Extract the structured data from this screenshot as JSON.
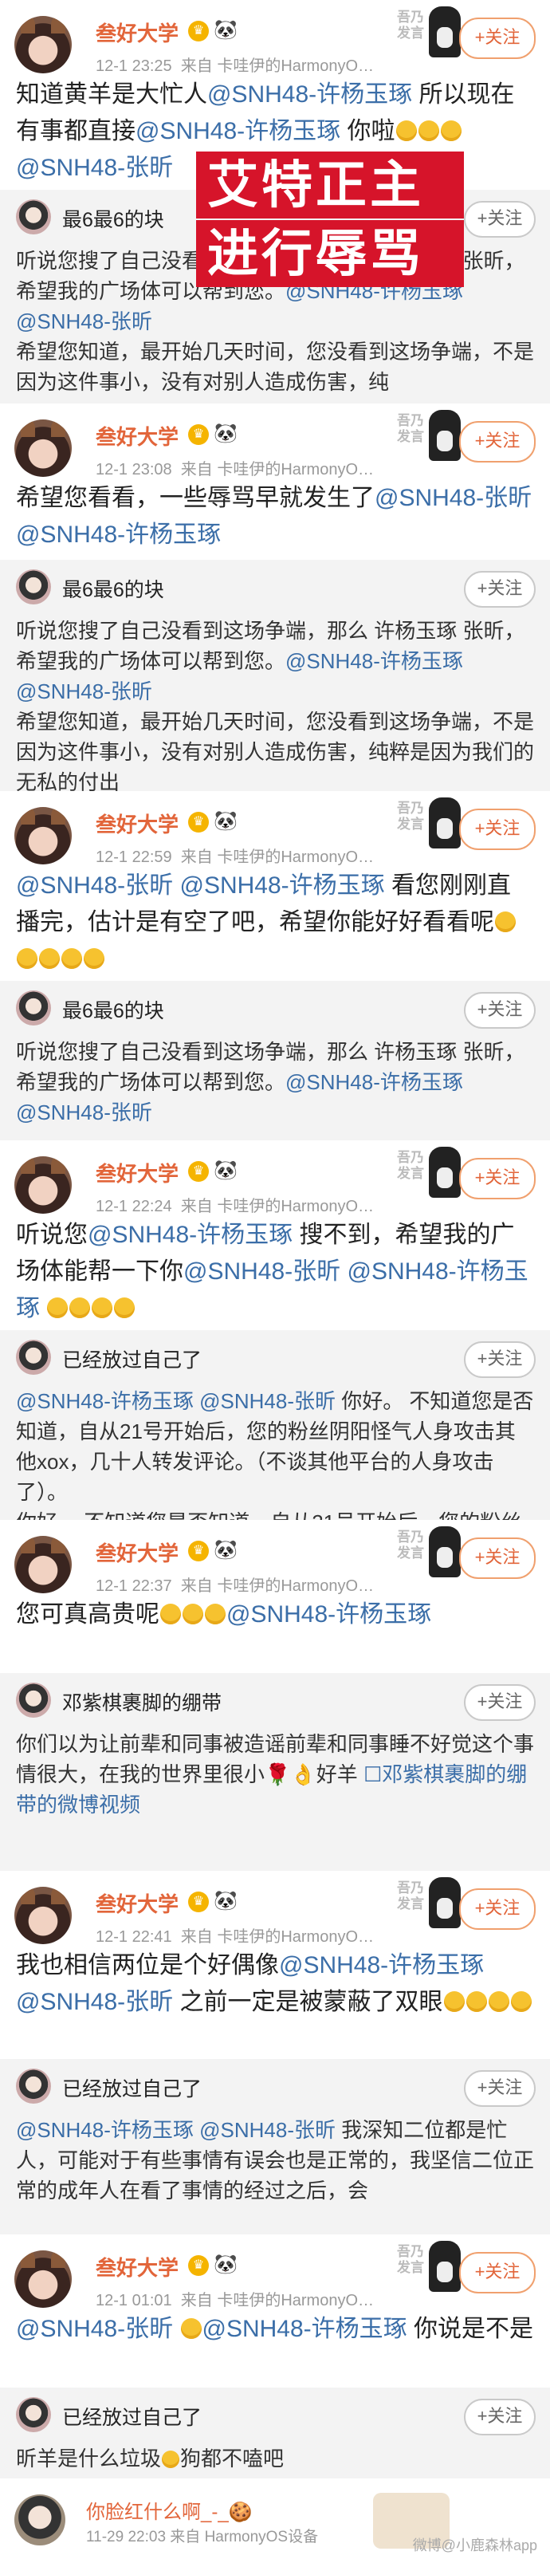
{
  "overlay": {
    "line1": "艾特正主",
    "line2": "进行辱骂"
  },
  "main_user": {
    "name": "叁好大学",
    "badge": "♛",
    "panda": "🐼",
    "follow_label": "+关注",
    "sticker_text": "吾乃发言"
  },
  "quote_follow_label": "+关注",
  "posts": [
    {
      "time": "12-1 23:25",
      "source": "来自 卡哇伊的HarmonyO…",
      "text_parts": [
        {
          "t": "知道黄羊是大忙人"
        },
        {
          "t": "@SNH48-许杨玉琢",
          "at": true
        },
        {
          "t": " 所以现在有事都直接"
        },
        {
          "t": "@SNH48-许杨玉琢",
          "at": true
        },
        {
          "t": " 你啦"
        },
        {
          "emo": 3
        },
        {
          "t": "\n"
        },
        {
          "t": "@SNH48-张昕",
          "at": true
        }
      ]
    },
    {
      "time": "12-1 23:08",
      "source": "来自 卡哇伊的HarmonyO…",
      "text_parts": [
        {
          "t": "希望您看看，一些辱骂早就发生了"
        },
        {
          "t": "@SNH48-张昕",
          "at": true
        },
        {
          "t": "\n"
        },
        {
          "t": "@SNH48-许杨玉琢",
          "at": true
        }
      ]
    },
    {
      "time": "12-1 22:59",
      "source": "来自 卡哇伊的HarmonyO…",
      "text_parts": [
        {
          "t": "@SNH48-张昕",
          "at": true
        },
        {
          "t": " "
        },
        {
          "t": "@SNH48-许杨玉琢",
          "at": true
        },
        {
          "t": " 看您刚刚直播完，估计是有空了吧，希望你能好好看看呢"
        },
        {
          "emo": 5
        }
      ]
    },
    {
      "time": "12-1 22:24",
      "source": "来自 卡哇伊的HarmonyO…",
      "text_parts": [
        {
          "t": "听说您"
        },
        {
          "t": "@SNH48-许杨玉琢",
          "at": true
        },
        {
          "t": " 搜不到，希望我的广场体能帮一下你"
        },
        {
          "t": "@SNH48-张昕",
          "at": true
        },
        {
          "t": " "
        },
        {
          "t": "@SNH48-许杨玉琢",
          "at": true
        },
        {
          "t": " "
        },
        {
          "emo": 4
        }
      ]
    },
    {
      "time": "12-1 22:37",
      "source": "来自 卡哇伊的HarmonyO…",
      "text_parts": [
        {
          "t": "您可真高贵呢"
        },
        {
          "emo": 3
        },
        {
          "t": "@SNH48-许杨玉琢",
          "at": true
        }
      ]
    },
    {
      "time": "12-1 22:41",
      "source": "来自 卡哇伊的HarmonyO…",
      "text_parts": [
        {
          "t": "我也相信两位是个好偶像"
        },
        {
          "t": "@SNH48-许杨玉琢",
          "at": true
        },
        {
          "t": "\n"
        },
        {
          "t": "@SNH48-张昕",
          "at": true
        },
        {
          "t": " 之前一定是被蒙蔽了双眼"
        },
        {
          "emo": 4
        }
      ]
    },
    {
      "time": "12-1 01:01",
      "source": "来自 卡哇伊的HarmonyO…",
      "text_parts": [
        {
          "t": "@SNH48-张昕",
          "at": true
        },
        {
          "t": " "
        },
        {
          "emo": 1
        },
        {
          "t": "@SNH48-许杨玉琢",
          "at": true
        },
        {
          "t": " 你说是不是"
        }
      ]
    }
  ],
  "quotes": [
    {
      "name": "最6最6的块",
      "text_parts": [
        {
          "t": "听说您搜了自己没看到这场争端，那么 许杨玉琢 张昕，希望我的广场体可以帮到您。"
        },
        {
          "t": "@SNH48-许杨玉琢",
          "at": true
        },
        {
          "t": " "
        },
        {
          "t": "@SNH48-张昕",
          "at": true
        },
        {
          "t": "\n希望您知道，最开始几天时间，您没看到这场争端，不是因为这件事小，没有对别人造成伤害，纯"
        }
      ]
    },
    {
      "name": "最6最6的块",
      "text_parts": [
        {
          "t": "听说您搜了自己没看到这场争端，那么 许杨玉琢 张昕，希望我的广场体可以帮到您。"
        },
        {
          "t": "@SNH48-许杨玉琢",
          "at": true
        },
        {
          "t": " "
        },
        {
          "t": "@SNH48-张昕",
          "at": true
        },
        {
          "t": "\n希望您知道，最开始几天时间，您没看到这场争端，不是因为这件事小，没有对别人造成伤害，纯粹是因为我们的无私的付出"
        }
      ]
    },
    {
      "name": "最6最6的块",
      "text_parts": [
        {
          "t": "听说您搜了自己没看到这场争端，那么 许杨玉琢 张昕，希望我的广场体可以帮到您。"
        },
        {
          "t": "@SNH48-许杨玉琢",
          "at": true
        },
        {
          "t": " "
        },
        {
          "t": "@SNH48-张昕",
          "at": true
        }
      ]
    },
    {
      "name": "已经放过自己了",
      "text_parts": [
        {
          "t": "@SNH48-许杨玉琢",
          "at": true
        },
        {
          "t": " "
        },
        {
          "t": "@SNH48-张昕",
          "at": true
        },
        {
          "t": " 你好。\n不知道您是否知道，自从21号开始后，您的粉丝阴阳怪气人身攻击其他xox，几十人转发评论。（不谈其他平台的人身攻击了）。"
        }
      ]
    },
    {
      "name": "邓紫棋裹脚的绷带",
      "text_parts": [
        {
          "t": "你们以为让前辈和同事被造谣前辈和同事睡不好觉这个事情很大，在我的世界里很小🌹👌好羊 "
        },
        {
          "t": "☐邓紫棋裹脚的绷带的微博视频",
          "at": true
        }
      ]
    },
    {
      "name": "已经放过自己了",
      "text_parts": [
        {
          "t": "@SNH48-许杨玉琢",
          "at": true
        },
        {
          "t": " "
        },
        {
          "t": "@SNH48-张昕",
          "at": true
        },
        {
          "t": " 我深知二位都是忙人，可能对于有些事情有误会也是正常的，我坚信二位正常的成年人在看了事情的经过之后，会"
        }
      ]
    },
    {
      "name": "已经放过自己了",
      "text_parts": [
        {
          "t": "昕羊是什么垃圾"
        },
        {
          "emo": 1
        },
        {
          "t": "狗都不嗑吧"
        }
      ]
    }
  ],
  "footer": {
    "name": "你脸红什么啊_-_🍪",
    "time": "11-29 22:03",
    "source": "来自 HarmonyOS设备",
    "watermark": "微博@小鹿森林app"
  },
  "colors": {
    "name_orange": "#e2653a",
    "mention_blue": "#3b6ea8",
    "overlay_red": "#d6142a"
  }
}
